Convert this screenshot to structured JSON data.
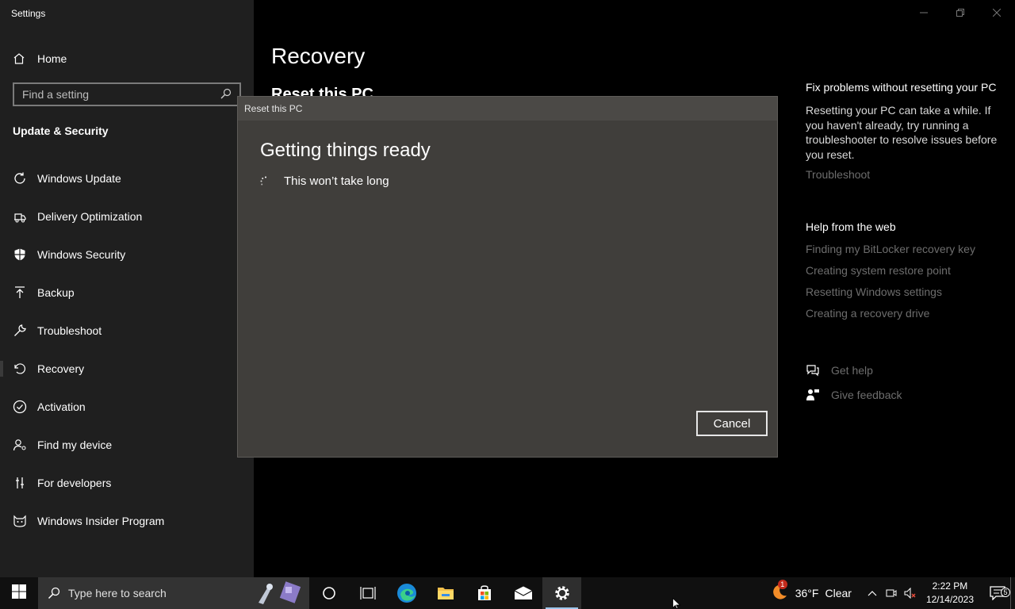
{
  "window": {
    "title": "Settings",
    "minimize_icon": "minimize-icon",
    "restore_icon": "restore-icon",
    "close_icon": "close-icon"
  },
  "sidebar": {
    "home_label": "Home",
    "search_placeholder": "Find a setting",
    "section_title": "Update & Security",
    "items": [
      {
        "label": "Windows Update",
        "icon": "refresh-icon"
      },
      {
        "label": "Delivery Optimization",
        "icon": "delivery-icon"
      },
      {
        "label": "Windows Security",
        "icon": "shield-icon"
      },
      {
        "label": "Backup",
        "icon": "upload-icon"
      },
      {
        "label": "Troubleshoot",
        "icon": "wrench-icon"
      },
      {
        "label": "Recovery",
        "icon": "recovery-icon",
        "active": true
      },
      {
        "label": "Activation",
        "icon": "check-circle-icon"
      },
      {
        "label": "Find my device",
        "icon": "person-pin-icon"
      },
      {
        "label": "For developers",
        "icon": "tools-icon"
      },
      {
        "label": "Windows Insider Program",
        "icon": "cat-icon"
      }
    ]
  },
  "main": {
    "title": "Recovery",
    "subtitle": "Reset this PC"
  },
  "right_panel": {
    "fix_heading": "Fix problems without resetting your PC",
    "fix_text": "Resetting your PC can take a while. If you haven't already, try running a troubleshooter to resolve issues before you reset.",
    "troubleshoot_link": "Troubleshoot",
    "web_heading": "Help from the web",
    "web_links": [
      "Finding my BitLocker recovery key",
      "Creating system restore point",
      "Resetting Windows settings",
      "Creating a recovery drive"
    ],
    "get_help": "Get help",
    "give_feedback": "Give feedback"
  },
  "dialog": {
    "title": "Reset this PC",
    "heading": "Getting things ready",
    "message": "This won’t take long",
    "cancel_label": "Cancel"
  },
  "taskbar": {
    "search_placeholder": "Type here to search",
    "weather_temp": "36°F",
    "weather_desc": "Clear",
    "time": "2:22 PM",
    "date": "12/14/2023",
    "notification_count": "5",
    "weather_badge": "1",
    "accent": "#9cc6ec"
  }
}
